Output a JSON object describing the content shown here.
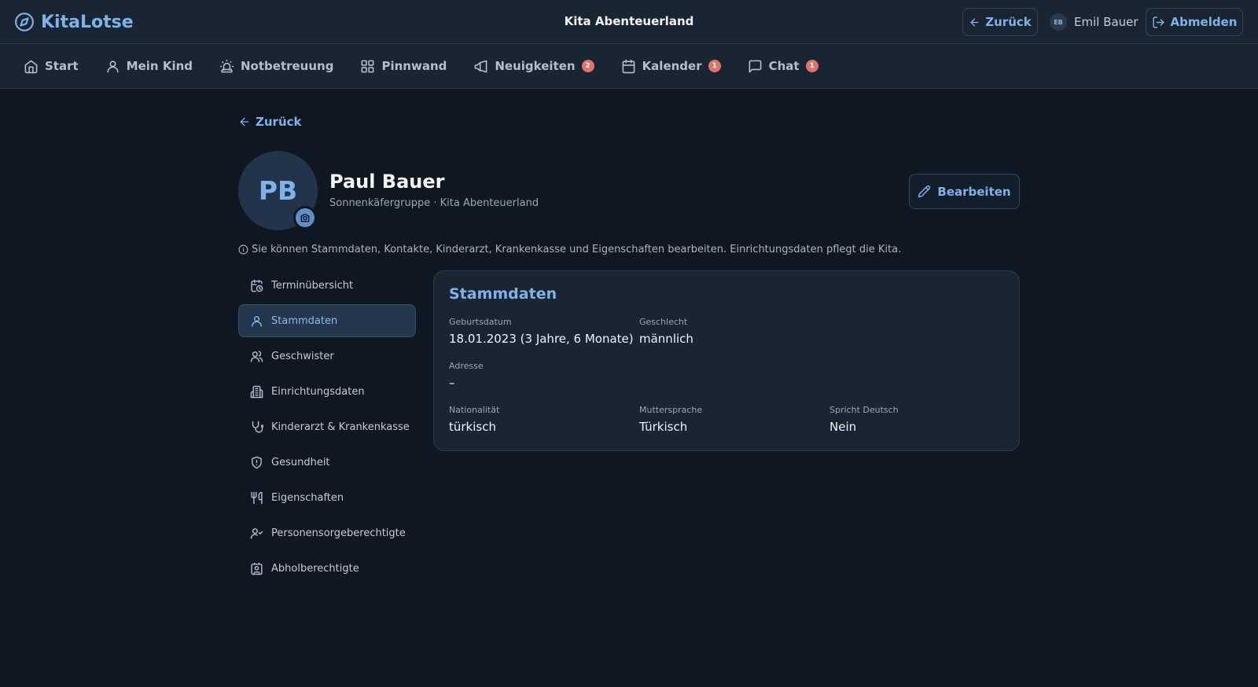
{
  "app": {
    "name": "KitaLotse",
    "center_title": "Kita Abenteuerland"
  },
  "topbar": {
    "back_label": "Zurück",
    "user_initials": "EB",
    "user_name": "Emil Bauer",
    "logout_label": "Abmelden"
  },
  "nav": {
    "items": [
      {
        "label": "Start",
        "icon": "home-icon"
      },
      {
        "label": "Mein Kind",
        "icon": "user-icon"
      },
      {
        "label": "Notbetreuung",
        "icon": "siren-icon"
      },
      {
        "label": "Pinnwand",
        "icon": "grid-icon"
      },
      {
        "label": "Neuigkeiten",
        "icon": "megaphone-icon",
        "badge": "2"
      },
      {
        "label": "Kalender",
        "icon": "calendar-icon",
        "badge": "1"
      },
      {
        "label": "Chat",
        "icon": "chat-icon",
        "badge": "1"
      }
    ]
  },
  "content": {
    "back_label": "Zurück",
    "avatar_initials": "PB",
    "child_name": "Paul Bauer",
    "child_subtitle": "Sonnenkäfergruppe · Kita Abenteuerland",
    "edit_label": "Bearbeiten",
    "info_text": "Sie können Stammdaten, Kontakte, Kinderarzt, Krankenkasse und Eigenschaften bearbeiten. Einrichtungsdaten pflegt die Kita."
  },
  "side_menu": {
    "items": [
      {
        "label": "Terminübersicht",
        "icon": "calendar-clock-icon"
      },
      {
        "label": "Stammdaten",
        "icon": "user-icon",
        "active": true
      },
      {
        "label": "Geschwister",
        "icon": "users-icon"
      },
      {
        "label": "Einrichtungsdaten",
        "icon": "building-icon"
      },
      {
        "label": "Kinderarzt & Krankenkasse",
        "icon": "stethoscope-icon"
      },
      {
        "label": "Gesundheit",
        "icon": "shield-alert-icon"
      },
      {
        "label": "Eigenschaften",
        "icon": "utensils-icon"
      },
      {
        "label": "Personensorgeberechtigte",
        "icon": "user-check-icon"
      },
      {
        "label": "Abholberechtigte",
        "icon": "contact-icon"
      }
    ]
  },
  "card": {
    "title": "Stammdaten",
    "fields": {
      "birthdate": {
        "label": "Geburtsdatum",
        "value": "18.01.2023 (3 Jahre, 6 Monate)"
      },
      "gender": {
        "label": "Geschlecht",
        "value": "männlich"
      },
      "address": {
        "label": "Adresse",
        "value": "–"
      },
      "nationality": {
        "label": "Nationalität",
        "value": "türkisch"
      },
      "mother_tongue": {
        "label": "Muttersprache",
        "value": "Türkisch"
      },
      "speaks_german": {
        "label": "Spricht Deutsch",
        "value": "Nein"
      }
    }
  },
  "colors": {
    "background": "#0f1722",
    "surface": "#1a2533",
    "accent": "#7fb2e8",
    "badge": "#e2736a"
  }
}
